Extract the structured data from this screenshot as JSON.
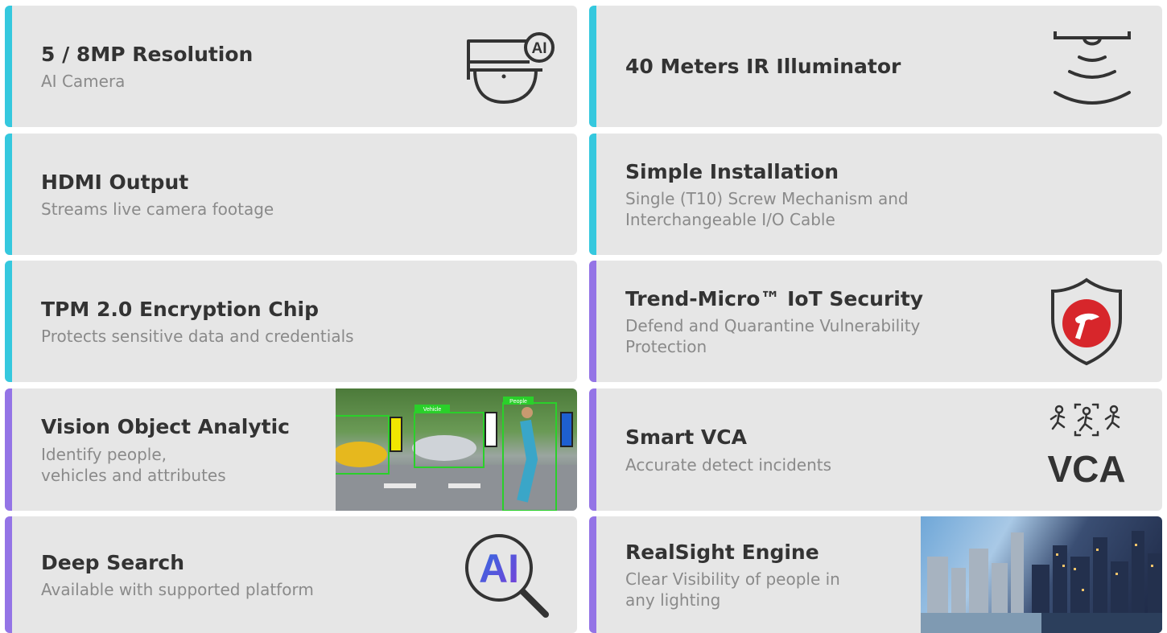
{
  "colors": {
    "card_bg": "#e6e6e6",
    "accent_cyan": "#35c8de",
    "accent_purple": "#9474e6",
    "title": "#333333",
    "subtitle": "#8a8a8a",
    "shield_red": "#d7262b",
    "ai_blue": "#2f6de0"
  },
  "features": [
    {
      "title": "5 / 8MP Resolution",
      "subtitle": "AI Camera",
      "icon": "ai-dome-camera-icon",
      "accent": "cyan",
      "icon_text": "AI"
    },
    {
      "title": "40 Meters IR Illuminator",
      "subtitle": "",
      "icon": "ir-illuminator-icon",
      "accent": "cyan"
    },
    {
      "title": "HDMI Output",
      "subtitle": "Streams live camera footage",
      "accent": "cyan"
    },
    {
      "title": "Simple Installation",
      "subtitle": "Single (T10) Screw Mechanism and\nInterchangeable I/O Cable",
      "accent": "cyan"
    },
    {
      "title": "TPM 2.0 Encryption Chip",
      "subtitle": "Protects sensitive data and credentials",
      "accent": "cyan"
    },
    {
      "title": "Trend-Micro™ IoT Security",
      "subtitle": "Defend and Quarantine Vulnerability\nProtection",
      "icon": "trend-micro-shield-icon",
      "accent": "purple"
    },
    {
      "title": "Vision Object Analytic",
      "subtitle": "Identify people,\nvehicles and attributes",
      "image": "street-detection-photo",
      "accent": "purple",
      "image_labels": [
        "Vehicle",
        "Vehicle",
        "People"
      ]
    },
    {
      "title": "Smart VCA",
      "subtitle": "Accurate detect incidents",
      "icon": "vca-icon",
      "accent": "purple",
      "icon_text": "VCA"
    },
    {
      "title": "Deep Search",
      "subtitle": "Available with supported platform",
      "icon": "ai-search-icon",
      "accent": "purple",
      "icon_text": "AI"
    },
    {
      "title": "RealSight Engine",
      "subtitle": "Clear Visibility of people in\nany lighting",
      "image": "city-skyline-photo",
      "accent": "purple"
    }
  ]
}
